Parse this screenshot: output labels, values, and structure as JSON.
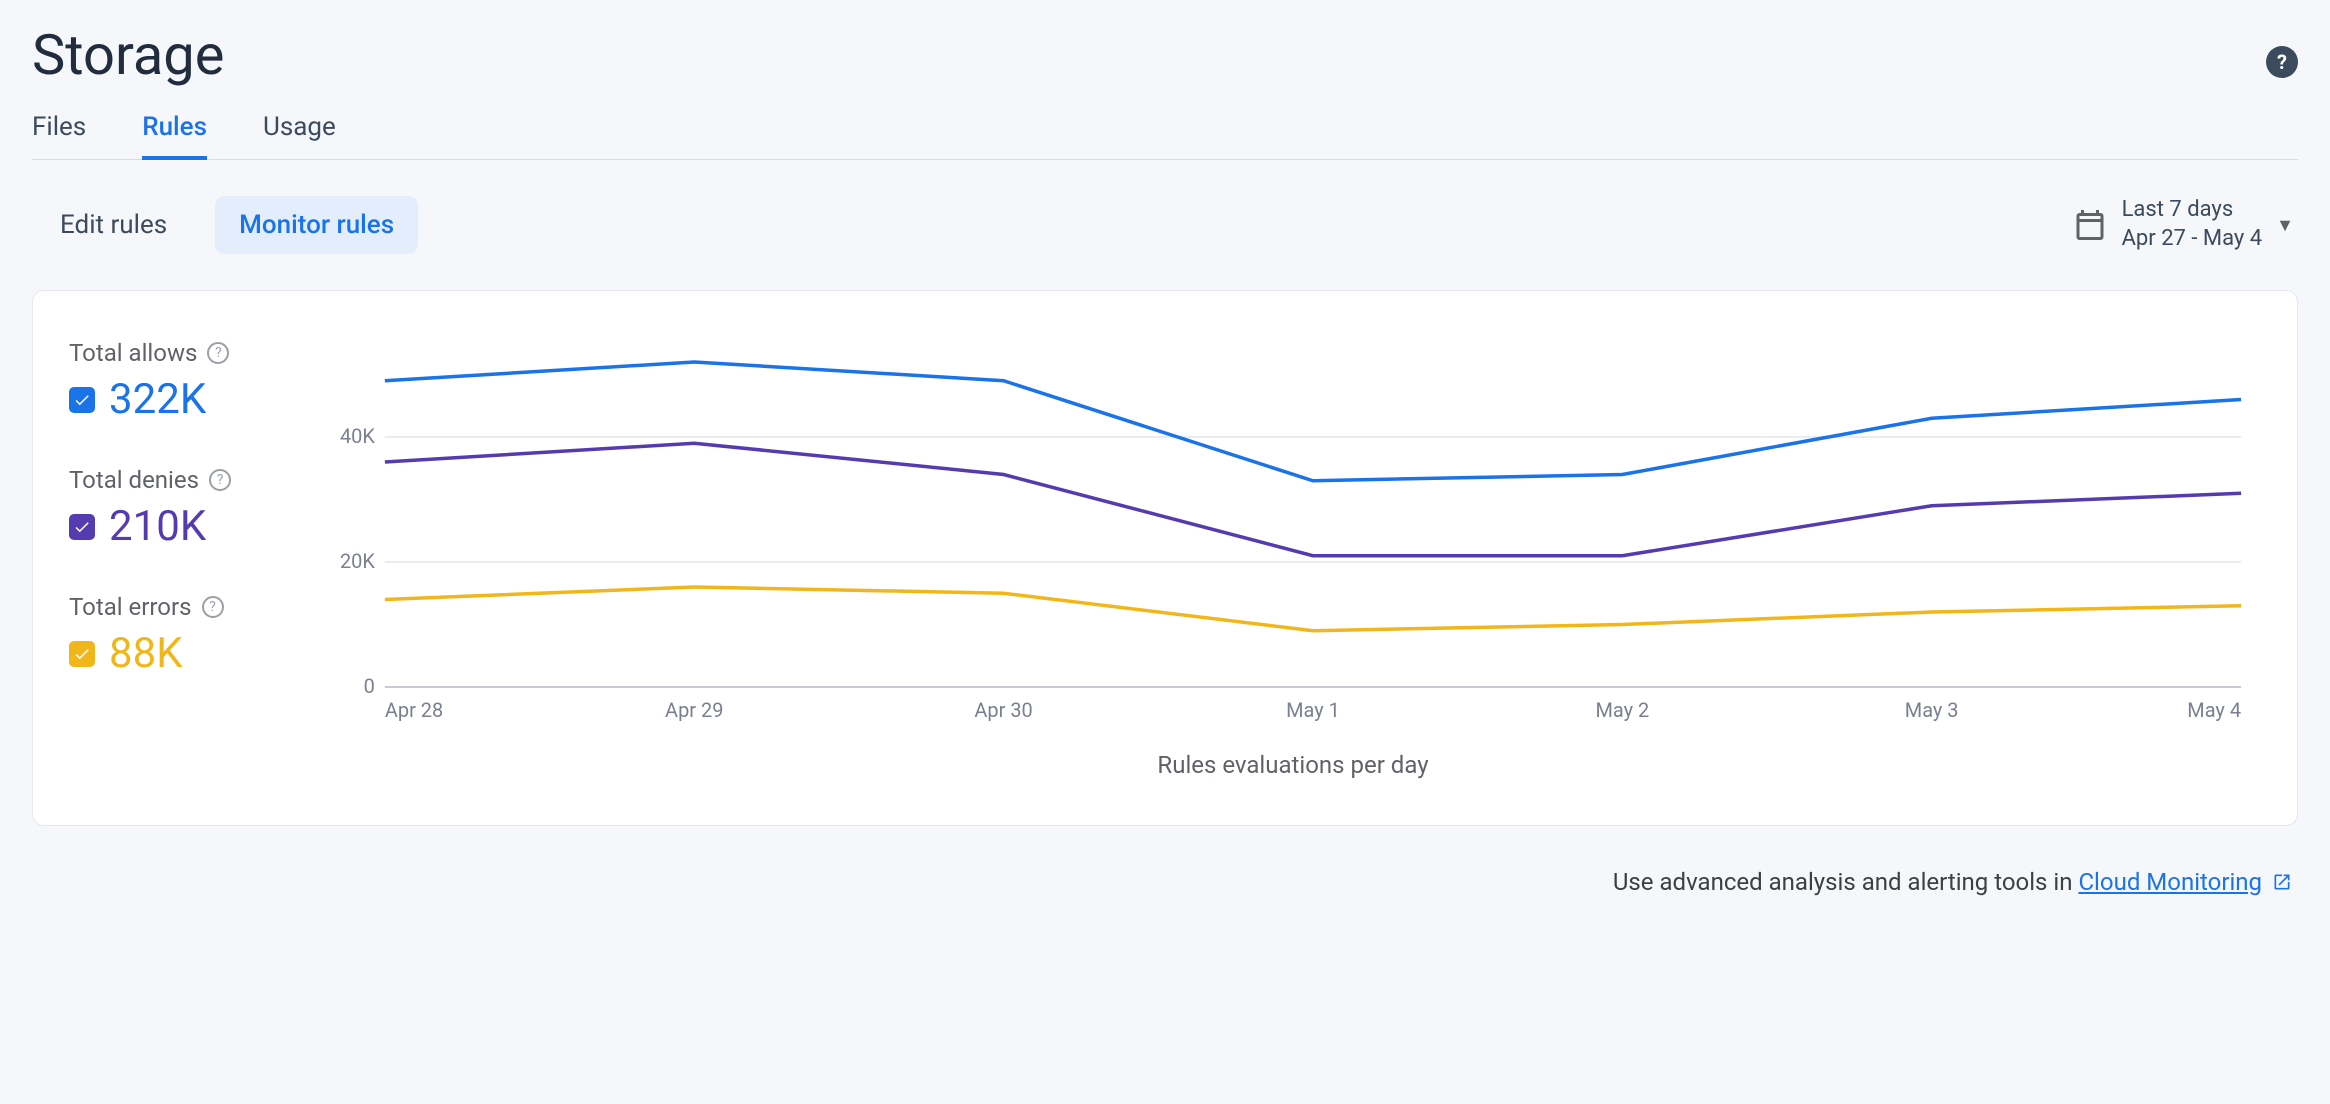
{
  "header": {
    "title": "Storage",
    "help_icon_label": "?"
  },
  "tabs": [
    {
      "label": "Files",
      "active": false
    },
    {
      "label": "Rules",
      "active": true
    },
    {
      "label": "Usage",
      "active": false
    }
  ],
  "subtabs": [
    {
      "label": "Edit rules",
      "active": false
    },
    {
      "label": "Monitor rules",
      "active": true
    }
  ],
  "date_picker": {
    "main": "Last 7 days",
    "range": "Apr 27 - May 4"
  },
  "legend": {
    "allows": {
      "label": "Total allows",
      "value": "322K",
      "color": "#1a73e8"
    },
    "denies": {
      "label": "Total denies",
      "value": "210K",
      "color": "#553bb0"
    },
    "errors": {
      "label": "Total errors",
      "value": "88K",
      "color": "#f1b619"
    }
  },
  "footer": {
    "prefix": "Use advanced analysis and alerting tools in ",
    "link_text": "Cloud Monitoring"
  },
  "chart_data": {
    "type": "line",
    "title": "",
    "xlabel": "Rules evaluations per day",
    "ylabel": "",
    "ylim": [
      0,
      56000
    ],
    "x": [
      "Apr 28",
      "Apr 29",
      "Apr 30",
      "May 1",
      "May 2",
      "May 3",
      "May 4"
    ],
    "y_ticks": [
      0,
      20000,
      40000
    ],
    "y_tick_labels": [
      "0",
      "20K",
      "40K"
    ],
    "series": [
      {
        "name": "Total allows",
        "color": "#1a73e8",
        "values": [
          49000,
          52000,
          49000,
          33000,
          34000,
          43000,
          46000
        ]
      },
      {
        "name": "Total denies",
        "color": "#553bb0",
        "values": [
          36000,
          39000,
          34000,
          21000,
          21000,
          29000,
          31000
        ]
      },
      {
        "name": "Total errors",
        "color": "#f1b619",
        "values": [
          14000,
          16000,
          15000,
          9000,
          10000,
          12000,
          13000
        ]
      }
    ]
  }
}
